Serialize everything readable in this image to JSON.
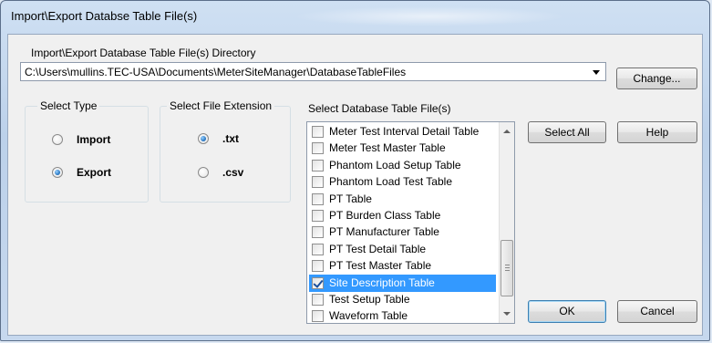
{
  "window": {
    "title": "Import\\Export Databse Table File(s)"
  },
  "directory": {
    "label": "Import\\Export Database Table File(s) Directory",
    "path": "C:\\Users\\mullins.TEC-USA\\Documents\\MeterSiteManager\\DatabaseTableFiles",
    "change_label": "Change..."
  },
  "select_type": {
    "title": "Select Type",
    "options": [
      {
        "label": "Import",
        "selected": false
      },
      {
        "label": "Export",
        "selected": true
      }
    ]
  },
  "file_extension": {
    "title": "Select File Extension",
    "options": [
      {
        "label": ".txt",
        "selected": true
      },
      {
        "label": ".csv",
        "selected": false
      }
    ]
  },
  "tables": {
    "title": "Select Database Table File(s)",
    "items": [
      {
        "label": "Meter Test Interval Detail Table",
        "checked": false,
        "selected": false
      },
      {
        "label": "Meter Test Master Table",
        "checked": false,
        "selected": false
      },
      {
        "label": "Phantom Load Setup Table",
        "checked": false,
        "selected": false
      },
      {
        "label": "Phantom Load Test Table",
        "checked": false,
        "selected": false
      },
      {
        "label": "PT Table",
        "checked": false,
        "selected": false
      },
      {
        "label": "PT Burden Class Table",
        "checked": false,
        "selected": false
      },
      {
        "label": "PT Manufacturer Table",
        "checked": false,
        "selected": false
      },
      {
        "label": "PT Test Detail Table",
        "checked": false,
        "selected": false
      },
      {
        "label": "PT Test Master Table",
        "checked": false,
        "selected": false
      },
      {
        "label": "Site Description Table",
        "checked": true,
        "selected": true
      },
      {
        "label": "Test Setup Table",
        "checked": false,
        "selected": false
      },
      {
        "label": "Waveform Table",
        "checked": false,
        "selected": false
      }
    ]
  },
  "buttons": {
    "select_all": "Select All",
    "help": "Help",
    "ok": "OK",
    "cancel": "Cancel"
  },
  "colors": {
    "selection": "#3399ff",
    "checkmark": "#1b4f9c",
    "radio_dot": "#1f6fbd"
  }
}
